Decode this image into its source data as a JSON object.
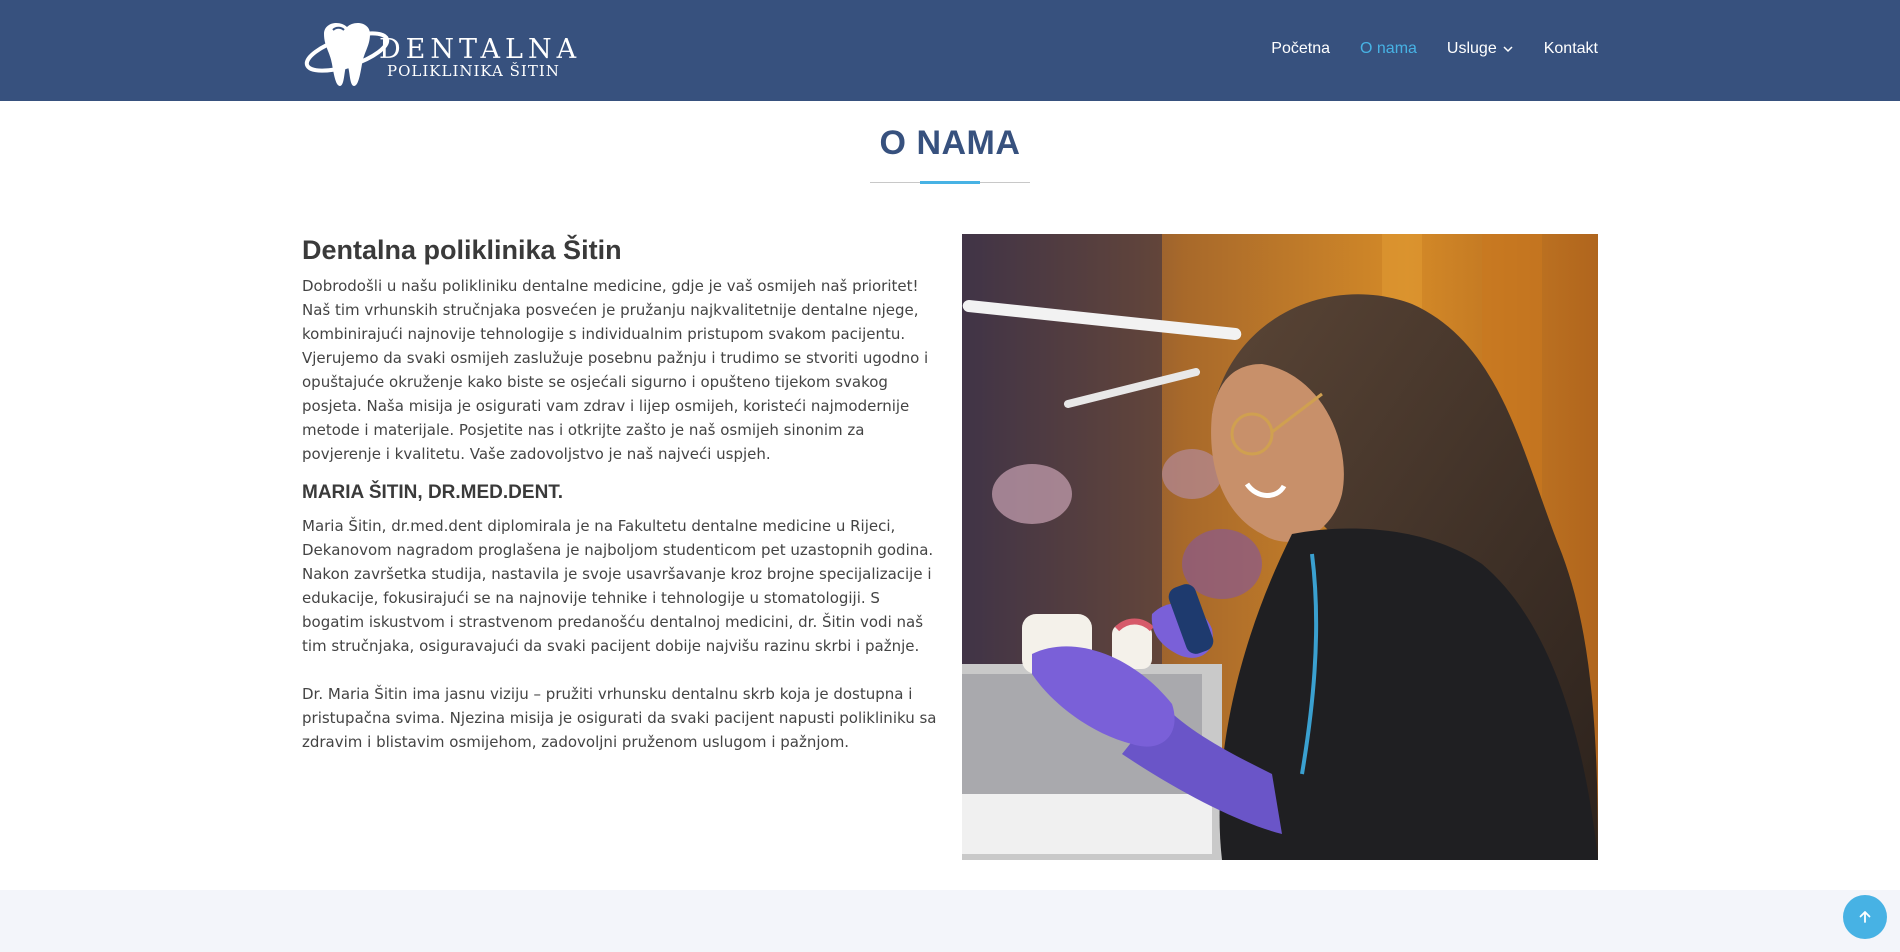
{
  "brand": {
    "name_big": "DENTALNA",
    "name_small": "POLIKLINIKA ŠITIN",
    "logo_icon": "tooth-logo-icon"
  },
  "nav": {
    "items": [
      {
        "label": "Početna",
        "active": false
      },
      {
        "label": "O nama",
        "active": true
      },
      {
        "label": "Usluge",
        "active": false,
        "has_dropdown": true
      },
      {
        "label": "Kontakt",
        "active": false
      }
    ]
  },
  "section": {
    "title": "O NAMA"
  },
  "about": {
    "heading": "Dentalna poliklinika Šitin",
    "intro": "Dobrodošli u našu polikliniku dentalne medicine, gdje je vaš osmijeh naš prioritet! Naš tim vrhunskih stručnjaka posvećen je pružanju najkvalitetnije dentalne njege, kombinirajući najnovije tehnologije s individualnim pristupom svakom pacijentu. Vjerujemo da svaki osmijeh zaslužuje posebnu pažnju i trudimo se stvoriti ugodno i opuštajuće okruženje kako biste se osjećali sigurno i opušteno tijekom svakog posjeta. Naša misija je osigurati vam zdrav i lijep osmijeh, koristeći najmodernije metode i materijale. Posjetite nas i otkrijte zašto je naš osmijeh sinonim za povjerenje i kvalitetu. Vaše zadovoljstvo je naš najveći uspjeh.",
    "doctor_heading": "MARIA ŠITIN, DR.MED.DENT.",
    "doctor_bio": "Maria Šitin, dr.med.dent diplomirala je na Fakultetu dentalne medicine u Rijeci, Dekanovom nagradom proglašena je najboljom studenticom pet uzastopnih godina. Nakon završetka studija, nastavila je svoje usavršavanje kroz brojne specijalizacije i edukacije, fokusirajući se na najnovije tehnike i tehnologije u stomatologiji. S bogatim iskustvom i strastvenom predanošću dentalnoj medicini, dr. Šitin vodi naš tim stručnjaka, osiguravajući da svaki pacijent dobije najvišu razinu skrbi i pažnje.",
    "doctor_vision": "Dr. Maria Šitin ima jasnu viziju – pružiti vrhunsku dentalnu skrb koja je dostupna i pristupačna svima. Njezina misija je osigurati da svaki pacijent napusti polikliniku sa zdravim i blistavim osmijehom, zadovoljni pruženom uslugom i pažnjom."
  },
  "photo": {
    "subject": "dentist-photo"
  },
  "colors": {
    "header_bg": "#37517e",
    "accent": "#47b2e4",
    "bottom_band": "#f3f5fa"
  },
  "back_to_top": {
    "icon": "arrow-up-icon"
  }
}
